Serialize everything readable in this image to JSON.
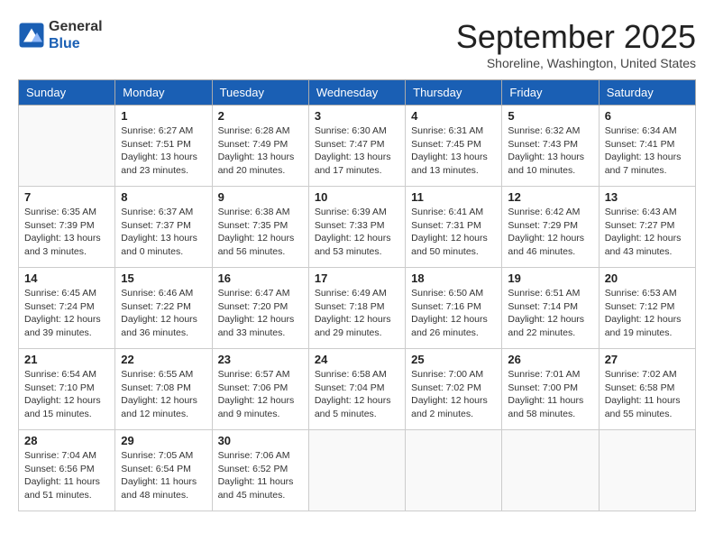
{
  "logo": {
    "general": "General",
    "blue": "Blue"
  },
  "title": "September 2025",
  "subtitle": "Shoreline, Washington, United States",
  "weekdays": [
    "Sunday",
    "Monday",
    "Tuesday",
    "Wednesday",
    "Thursday",
    "Friday",
    "Saturday"
  ],
  "weeks": [
    [
      {
        "day": "",
        "info": ""
      },
      {
        "day": "1",
        "info": "Sunrise: 6:27 AM\nSunset: 7:51 PM\nDaylight: 13 hours\nand 23 minutes."
      },
      {
        "day": "2",
        "info": "Sunrise: 6:28 AM\nSunset: 7:49 PM\nDaylight: 13 hours\nand 20 minutes."
      },
      {
        "day": "3",
        "info": "Sunrise: 6:30 AM\nSunset: 7:47 PM\nDaylight: 13 hours\nand 17 minutes."
      },
      {
        "day": "4",
        "info": "Sunrise: 6:31 AM\nSunset: 7:45 PM\nDaylight: 13 hours\nand 13 minutes."
      },
      {
        "day": "5",
        "info": "Sunrise: 6:32 AM\nSunset: 7:43 PM\nDaylight: 13 hours\nand 10 minutes."
      },
      {
        "day": "6",
        "info": "Sunrise: 6:34 AM\nSunset: 7:41 PM\nDaylight: 13 hours\nand 7 minutes."
      }
    ],
    [
      {
        "day": "7",
        "info": "Sunrise: 6:35 AM\nSunset: 7:39 PM\nDaylight: 13 hours\nand 3 minutes."
      },
      {
        "day": "8",
        "info": "Sunrise: 6:37 AM\nSunset: 7:37 PM\nDaylight: 13 hours\nand 0 minutes."
      },
      {
        "day": "9",
        "info": "Sunrise: 6:38 AM\nSunset: 7:35 PM\nDaylight: 12 hours\nand 56 minutes."
      },
      {
        "day": "10",
        "info": "Sunrise: 6:39 AM\nSunset: 7:33 PM\nDaylight: 12 hours\nand 53 minutes."
      },
      {
        "day": "11",
        "info": "Sunrise: 6:41 AM\nSunset: 7:31 PM\nDaylight: 12 hours\nand 50 minutes."
      },
      {
        "day": "12",
        "info": "Sunrise: 6:42 AM\nSunset: 7:29 PM\nDaylight: 12 hours\nand 46 minutes."
      },
      {
        "day": "13",
        "info": "Sunrise: 6:43 AM\nSunset: 7:27 PM\nDaylight: 12 hours\nand 43 minutes."
      }
    ],
    [
      {
        "day": "14",
        "info": "Sunrise: 6:45 AM\nSunset: 7:24 PM\nDaylight: 12 hours\nand 39 minutes."
      },
      {
        "day": "15",
        "info": "Sunrise: 6:46 AM\nSunset: 7:22 PM\nDaylight: 12 hours\nand 36 minutes."
      },
      {
        "day": "16",
        "info": "Sunrise: 6:47 AM\nSunset: 7:20 PM\nDaylight: 12 hours\nand 33 minutes."
      },
      {
        "day": "17",
        "info": "Sunrise: 6:49 AM\nSunset: 7:18 PM\nDaylight: 12 hours\nand 29 minutes."
      },
      {
        "day": "18",
        "info": "Sunrise: 6:50 AM\nSunset: 7:16 PM\nDaylight: 12 hours\nand 26 minutes."
      },
      {
        "day": "19",
        "info": "Sunrise: 6:51 AM\nSunset: 7:14 PM\nDaylight: 12 hours\nand 22 minutes."
      },
      {
        "day": "20",
        "info": "Sunrise: 6:53 AM\nSunset: 7:12 PM\nDaylight: 12 hours\nand 19 minutes."
      }
    ],
    [
      {
        "day": "21",
        "info": "Sunrise: 6:54 AM\nSunset: 7:10 PM\nDaylight: 12 hours\nand 15 minutes."
      },
      {
        "day": "22",
        "info": "Sunrise: 6:55 AM\nSunset: 7:08 PM\nDaylight: 12 hours\nand 12 minutes."
      },
      {
        "day": "23",
        "info": "Sunrise: 6:57 AM\nSunset: 7:06 PM\nDaylight: 12 hours\nand 9 minutes."
      },
      {
        "day": "24",
        "info": "Sunrise: 6:58 AM\nSunset: 7:04 PM\nDaylight: 12 hours\nand 5 minutes."
      },
      {
        "day": "25",
        "info": "Sunrise: 7:00 AM\nSunset: 7:02 PM\nDaylight: 12 hours\nand 2 minutes."
      },
      {
        "day": "26",
        "info": "Sunrise: 7:01 AM\nSunset: 7:00 PM\nDaylight: 11 hours\nand 58 minutes."
      },
      {
        "day": "27",
        "info": "Sunrise: 7:02 AM\nSunset: 6:58 PM\nDaylight: 11 hours\nand 55 minutes."
      }
    ],
    [
      {
        "day": "28",
        "info": "Sunrise: 7:04 AM\nSunset: 6:56 PM\nDaylight: 11 hours\nand 51 minutes."
      },
      {
        "day": "29",
        "info": "Sunrise: 7:05 AM\nSunset: 6:54 PM\nDaylight: 11 hours\nand 48 minutes."
      },
      {
        "day": "30",
        "info": "Sunrise: 7:06 AM\nSunset: 6:52 PM\nDaylight: 11 hours\nand 45 minutes."
      },
      {
        "day": "",
        "info": ""
      },
      {
        "day": "",
        "info": ""
      },
      {
        "day": "",
        "info": ""
      },
      {
        "day": "",
        "info": ""
      }
    ]
  ]
}
